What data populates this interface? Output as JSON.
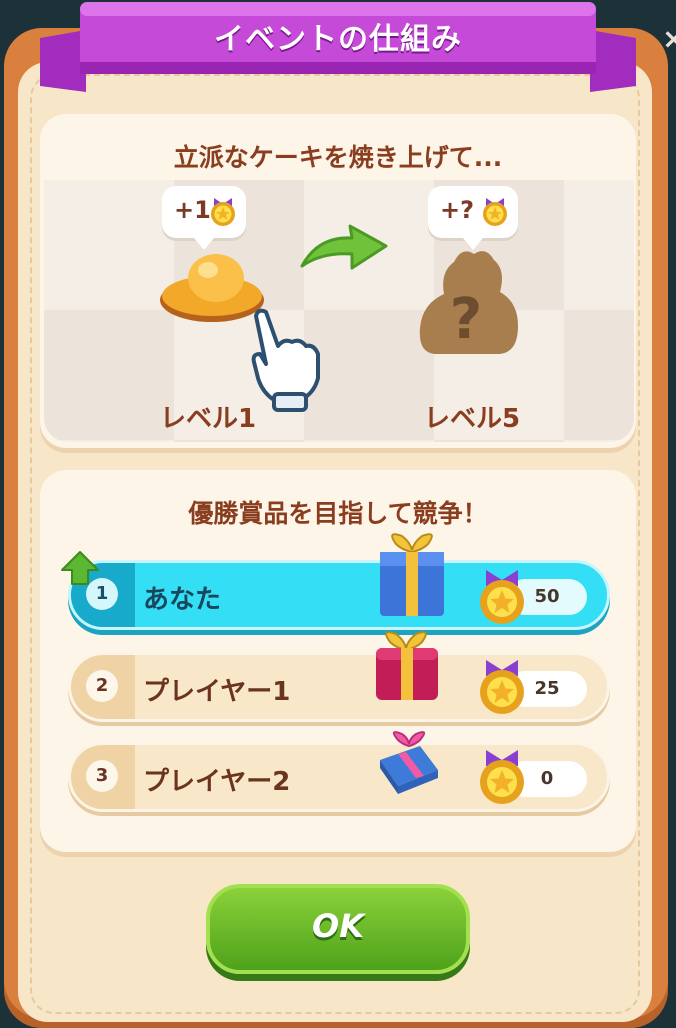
{
  "dialog": {
    "title": "イベントの仕組み",
    "close_icon": "close-icon"
  },
  "bake_card": {
    "title": "立派なケーキを焼き上げて...",
    "left": {
      "bubble": "+1",
      "level": "レベル1",
      "item_icon": "hat-cake-icon"
    },
    "right": {
      "bubble": "+?",
      "level": "レベル5",
      "item_icon": "mystery-cake-icon"
    },
    "arrow_icon": "green-arrow-icon",
    "hand_icon": "pointing-hand-icon"
  },
  "compete_card": {
    "title": "優勝賞品を目指して競争！",
    "rows": [
      {
        "rank": "1",
        "name": "あなた",
        "score": "50",
        "gift": "blue-gift-icon",
        "highlight": true
      },
      {
        "rank": "2",
        "name": "プレイヤー1",
        "score": "25",
        "gift": "red-gift-icon",
        "highlight": false
      },
      {
        "rank": "3",
        "name": "プレイヤー2",
        "score": "0",
        "gift": "small-blue-gift-icon",
        "highlight": false
      }
    ]
  },
  "ok_button": {
    "label": "OK"
  },
  "colors": {
    "banner": "#b93ad0",
    "frame": "#d9803e",
    "panel": "#f8e6c9",
    "highlight_row": "#34def5",
    "ok_green": "#6dbb2a",
    "text_brown": "#8a3d1f"
  }
}
